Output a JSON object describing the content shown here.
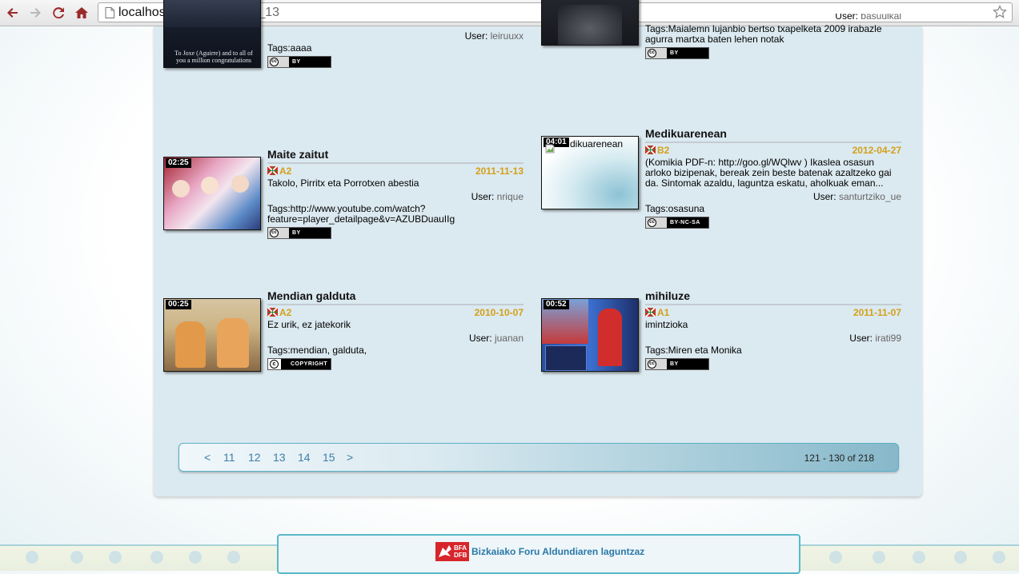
{
  "browser": {
    "url_host": "localhost",
    "url_path": "/#Practice/page_13"
  },
  "videos": [
    {
      "title": "",
      "level": "",
      "date": "",
      "description": "",
      "user_label": "User:",
      "user": "leiruuxx",
      "tags": "Tags:aaaa",
      "license": "BY",
      "thumb_caption": "To Joxe (Aguirre) and to all of you a million congratulations"
    },
    {
      "title": "",
      "level": "",
      "date": "",
      "description": "",
      "user_label": "User:",
      "user": "basuulkal",
      "tags": "Tags:Maialemn lujanbio bertso txapelketa 2009 irabazle agurra martxa baten lehen notak",
      "license": "BY"
    },
    {
      "title": "Maite zaitut",
      "duration": "02:25",
      "level": "A2",
      "date": "2011-11-13",
      "description": "Takolo, Pirritx eta Porrotxen abestia",
      "user_label": "User:",
      "user": "nrique",
      "tags": "Tags:http://www.youtube.com/watch?feature=player_detailpage&v=AZUBDuauIIg",
      "license": "BY"
    },
    {
      "title": "Medikuarenean",
      "duration": "04:01",
      "alt": "dikuarenean",
      "level": "B2",
      "date": "2012-04-27",
      "description": "(Komikia PDF-n: http://goo.gl/WQlwv ) Ikaslea osasun arloko bizipenak, bereak zein beste batenak azaltzeko gai da. Sintomak azaldu, laguntza eskatu, aholkuak eman...",
      "user_label": "User:",
      "user": "santurtziko_ue",
      "tags": "Tags:osasuna",
      "license": "BY-NC-SA"
    },
    {
      "title": "Mendian galduta",
      "duration": "00:25",
      "level": "A2",
      "date": "2010-10-07",
      "description": "Ez urik, ez jatekorik",
      "user_label": "User:",
      "user": "juanan",
      "tags": "Tags:mendian, galduta,",
      "license": "COPYRIGHT"
    },
    {
      "title": "mihiluze",
      "duration": "00:52",
      "level": "A1",
      "date": "2011-11-07",
      "description": "imintzioka",
      "user_label": "User:",
      "user": "irati99",
      "tags": "Tags:Miren eta Monika",
      "license": "BY"
    }
  ],
  "pagination": {
    "prev": "<",
    "pages": [
      "11",
      "12",
      "13",
      "14",
      "15"
    ],
    "next": ">",
    "count": "121 - 130 of 218"
  },
  "footer": {
    "logo_top": "BFA",
    "logo_bottom": "DFB",
    "text": "Bizkaiako Foru Aldundiaren laguntzaz"
  }
}
